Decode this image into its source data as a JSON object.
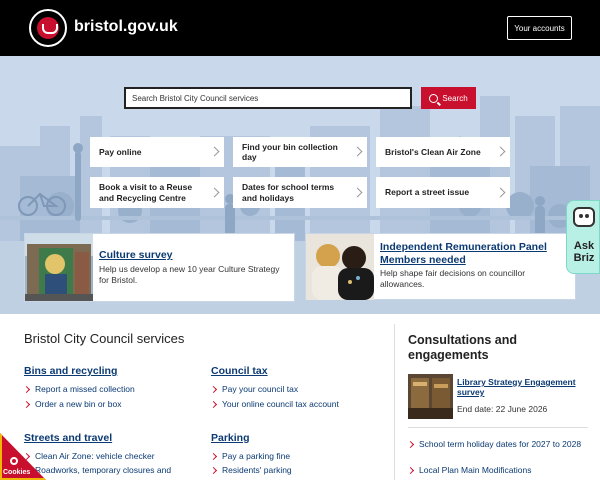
{
  "header": {
    "site_name": "bristol.gov.uk",
    "accounts_label": "Your accounts"
  },
  "search": {
    "placeholder": "Search Bristol City Council services",
    "button_label": "Search"
  },
  "quick_links": [
    {
      "label": "Pay online"
    },
    {
      "label": "Find your bin collection day"
    },
    {
      "label": "Bristol's Clean Air Zone"
    },
    {
      "label": "Book a visit to a Reuse and Recycling Centre"
    },
    {
      "label": "Dates for school terms and holidays"
    },
    {
      "label": "Report a street issue"
    }
  ],
  "features": [
    {
      "title": "Culture survey",
      "text": "Help us develop a new 10 year Culture Strategy for Bristol."
    },
    {
      "title": "Independent Remuneration Panel Members needed",
      "text": "Help shape fair decisions on councillor allowances."
    }
  ],
  "ask_briz": {
    "line1": "Ask",
    "line2": "Briz"
  },
  "services": {
    "title": "Bristol City Council services",
    "bins": {
      "heading": "Bins and recycling",
      "links": [
        "Report a missed collection",
        "Order a new bin or box"
      ]
    },
    "council_tax": {
      "heading": "Council tax",
      "links": [
        "Pay your council tax",
        "Your online council tax account"
      ]
    },
    "streets": {
      "heading": "Streets and travel",
      "links": [
        "Clean Air Zone: vehicle checker",
        "Roadworks, temporary closures and"
      ]
    },
    "parking": {
      "heading": "Parking",
      "links": [
        "Pay a parking fine",
        "Residents' parking"
      ]
    }
  },
  "consultations": {
    "title": "Consultations and engagements",
    "featured_link": "Library Strategy Engagement survey",
    "featured_date": "End date: 22 June 2026",
    "items": [
      "School term holiday dates for 2027 to 2028",
      "Local Plan Main Modifications"
    ]
  },
  "cookies": {
    "label": "Cookies"
  },
  "colors": {
    "brand_red": "#c8102e",
    "link_blue": "#0b3a73",
    "header_bg": "#000000",
    "hero_bg": "#c7d6e8"
  }
}
